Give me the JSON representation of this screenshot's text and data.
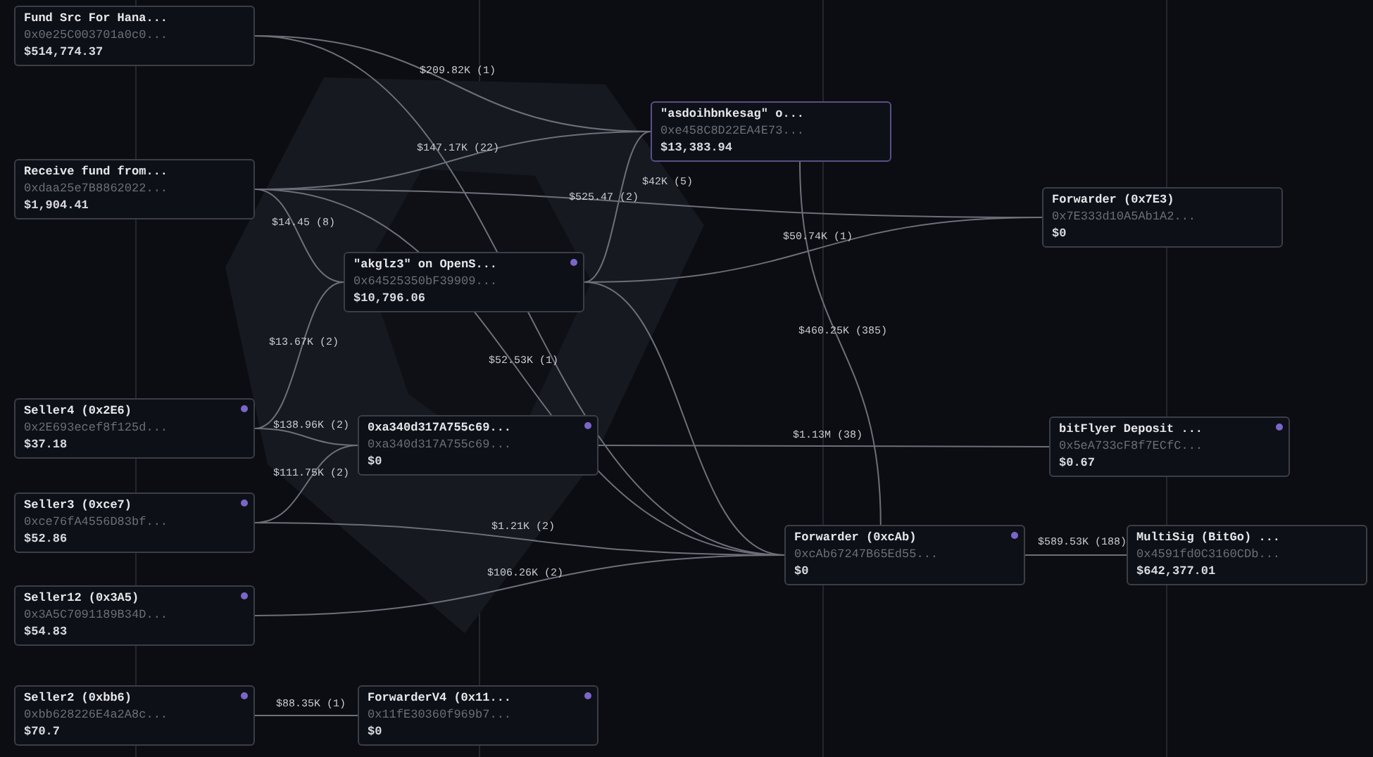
{
  "nodes": [
    {
      "title": "Fund Src For Hana...",
      "address": "0x0e25C003701a0c0...",
      "balance": "$514,774.37",
      "flagged": false,
      "selected": false
    },
    {
      "title": "Receive fund from...",
      "address": "0xdaa25e7B8862022...",
      "balance": "$1,904.41",
      "flagged": false,
      "selected": false
    },
    {
      "title": "\"akglz3\" on OpenS...",
      "address": "0x64525350bF39909...",
      "balance": "$10,796.06",
      "flagged": true,
      "selected": false
    },
    {
      "title": "\"asdoihbnkesag\" o...",
      "address": "0xe458C8D22EA4E73...",
      "balance": "$13,383.94",
      "flagged": false,
      "selected": true
    },
    {
      "title": "Forwarder (0x7E3)",
      "address": "0x7E333d10A5Ab1A2...",
      "balance": "$0",
      "flagged": false,
      "selected": false
    },
    {
      "title": "Seller4 (0x2E6)",
      "address": "0x2E693ecef8f125d...",
      "balance": "$37.18",
      "flagged": true,
      "selected": false
    },
    {
      "title": "0xa340d317A755c69...",
      "address": "0xa340d317A755c69...",
      "balance": "$0",
      "flagged": true,
      "selected": false
    },
    {
      "title": "bitFlyer Deposit ...",
      "address": "0x5eA733cF8f7ECfC...",
      "balance": "$0.67",
      "flagged": true,
      "selected": false
    },
    {
      "title": "Seller3 (0xce7)",
      "address": "0xce76fA4556D83bf...",
      "balance": "$52.86",
      "flagged": true,
      "selected": false
    },
    {
      "title": "Forwarder (0xcAb)",
      "address": "0xcAb67247B65Ed55...",
      "balance": "$0",
      "flagged": true,
      "selected": false
    },
    {
      "title": "MultiSig (BitGo) ...",
      "address": "0x4591fd0C3160CDb...",
      "balance": "$642,377.01",
      "flagged": false,
      "selected": false
    },
    {
      "title": "Seller12 (0x3A5)",
      "address": "0x3A5C7091189B34D...",
      "balance": "$54.83",
      "flagged": true,
      "selected": false
    },
    {
      "title": "Seller2 (0xbb6)",
      "address": "0xbb628226E4a2A8c...",
      "balance": "$70.7",
      "flagged": true,
      "selected": false
    },
    {
      "title": "ForwarderV4 (0x11...",
      "address": "0x11fE30360f969b7...",
      "balance": "$0",
      "flagged": true,
      "selected": false
    }
  ],
  "edge_labels": [
    "$209.82K (1)",
    "$147.17K (22)",
    "$525.47 (2)",
    "$42K (5)",
    "$14.45 (8)",
    "$13.67K (2)",
    "$50.74K (1)",
    "$460.25K (385)",
    "$52.53K (1)",
    "$138.96K (2)",
    "$111.75K (2)",
    "$1.13M (38)",
    "$1.21K (2)",
    "$106.26K (2)",
    "$589.53K (188)",
    "$88.35K (1)"
  ]
}
